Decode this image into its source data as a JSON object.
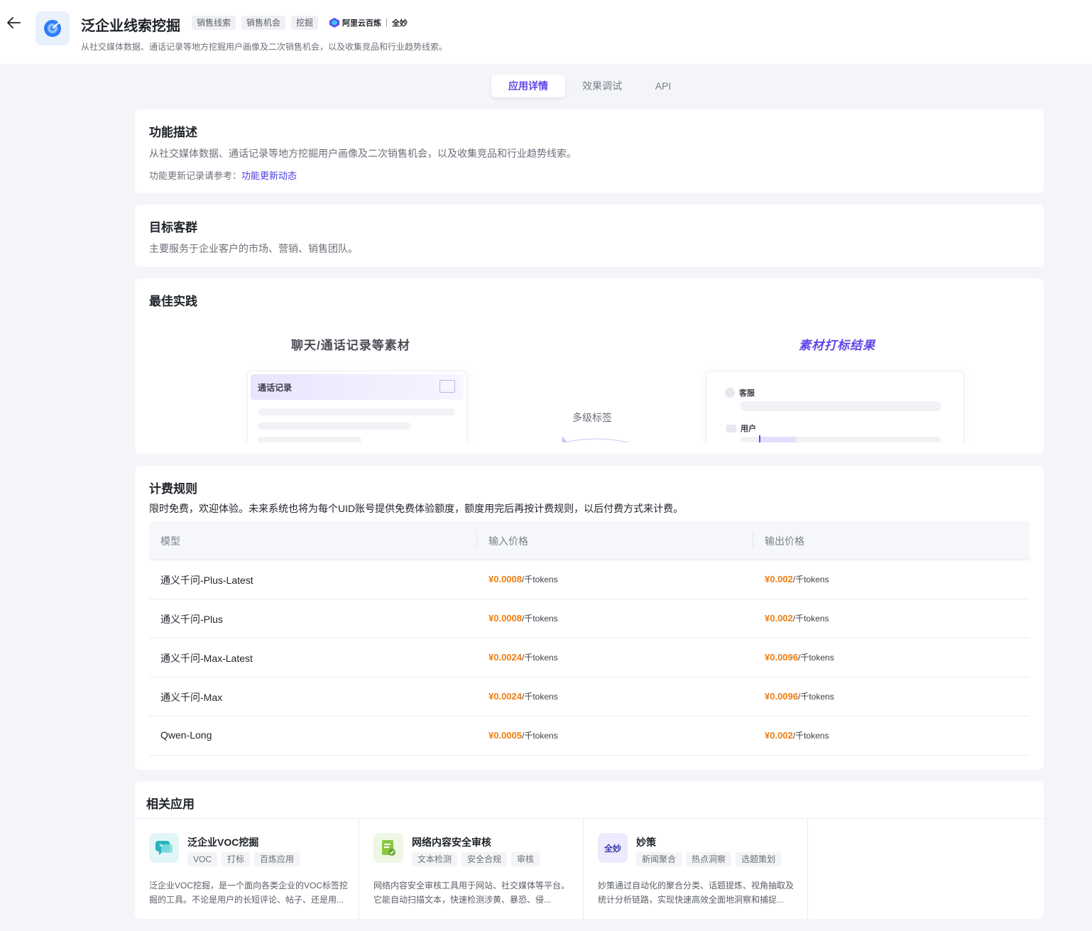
{
  "header": {
    "title": "泛企业线索挖掘",
    "tags": [
      "销售线索",
      "销售机会",
      "挖掘"
    ],
    "vendor": {
      "brand": "阿里云百炼",
      "product": "全妙"
    },
    "subtitle": "从社交媒体数据、通话记录等地方挖掘用户画像及二次销售机会，以及收集竞品和行业趋势线索。"
  },
  "tabs": [
    "应用详情",
    "效果调试",
    "API"
  ],
  "feature": {
    "title": "功能描述",
    "desc": "从社交媒体数据、通话记录等地方挖掘用户画像及二次销售机会，以及收集竞品和行业趋势线索。",
    "update_prefix": "功能更新记录请参考：",
    "update_link": "功能更新动态"
  },
  "audience": {
    "title": "目标客群",
    "desc": "主要服务于企业客户的市场、营销、销售团队。"
  },
  "best_practice": {
    "title": "最佳实践",
    "left_heading": "聊天/通话记录等素材",
    "right_heading": "素材打标结果",
    "left_card_title": "通话记录",
    "middle_label": "多级标签",
    "roles": [
      "客服",
      "用户"
    ]
  },
  "pricing": {
    "title": "计费规则",
    "note": "限时免费，欢迎体验。未来系统也将为每个UID账号提供免费体验额度，额度用完后再按计费规则，以后付费方式来计费。",
    "columns": [
      "模型",
      "输入价格",
      "输出价格"
    ],
    "unit": "/千tokens",
    "rows": [
      {
        "model": "通义千问-Plus-Latest",
        "input": "¥0.0008",
        "output": "¥0.002"
      },
      {
        "model": "通义千问-Plus",
        "input": "¥0.0008",
        "output": "¥0.002"
      },
      {
        "model": "通义千问-Max-Latest",
        "input": "¥0.0024",
        "output": "¥0.0096"
      },
      {
        "model": "通义千问-Max",
        "input": "¥0.0024",
        "output": "¥0.0096"
      },
      {
        "model": "Qwen-Long",
        "input": "¥0.0005",
        "output": "¥0.002"
      }
    ]
  },
  "related": {
    "title": "相关应用",
    "apps": [
      {
        "name": "泛企业VOC挖掘",
        "tags": [
          "VOC",
          "打标",
          "百炼应用"
        ],
        "desc": "泛企业VOC挖掘，是一个面向各类企业的VOC标签挖掘的工具。不论是用户的长短评论、帖子、还是用...",
        "icon": "chat-bubble-icon",
        "icon_bg": "#e2f6f7"
      },
      {
        "name": "网络内容安全审核",
        "tags": [
          "文本检测",
          "安全合规",
          "审核"
        ],
        "desc": "网络内容安全审核工具用于网站、社交媒体等平台。它能自动扫描文本，快速检测涉黄、暴恐、侵...",
        "icon": "document-check-icon",
        "icon_bg": "#eef7e4"
      },
      {
        "name": "妙策",
        "tags": [
          "新闻聚合",
          "热点洞察",
          "选题策划"
        ],
        "desc": "妙策通过自动化的聚合分类、话题提炼、视角抽取及统计分析链路，实现快速高效全面地洞察和捕捉...",
        "icon": "quanmiao-logo-icon",
        "icon_text": "全妙",
        "icon_bg": "#ecebfd"
      }
    ]
  },
  "colors": {
    "accent": "#6246e8",
    "price": "#f07d0e",
    "link": "#4b3de0"
  }
}
